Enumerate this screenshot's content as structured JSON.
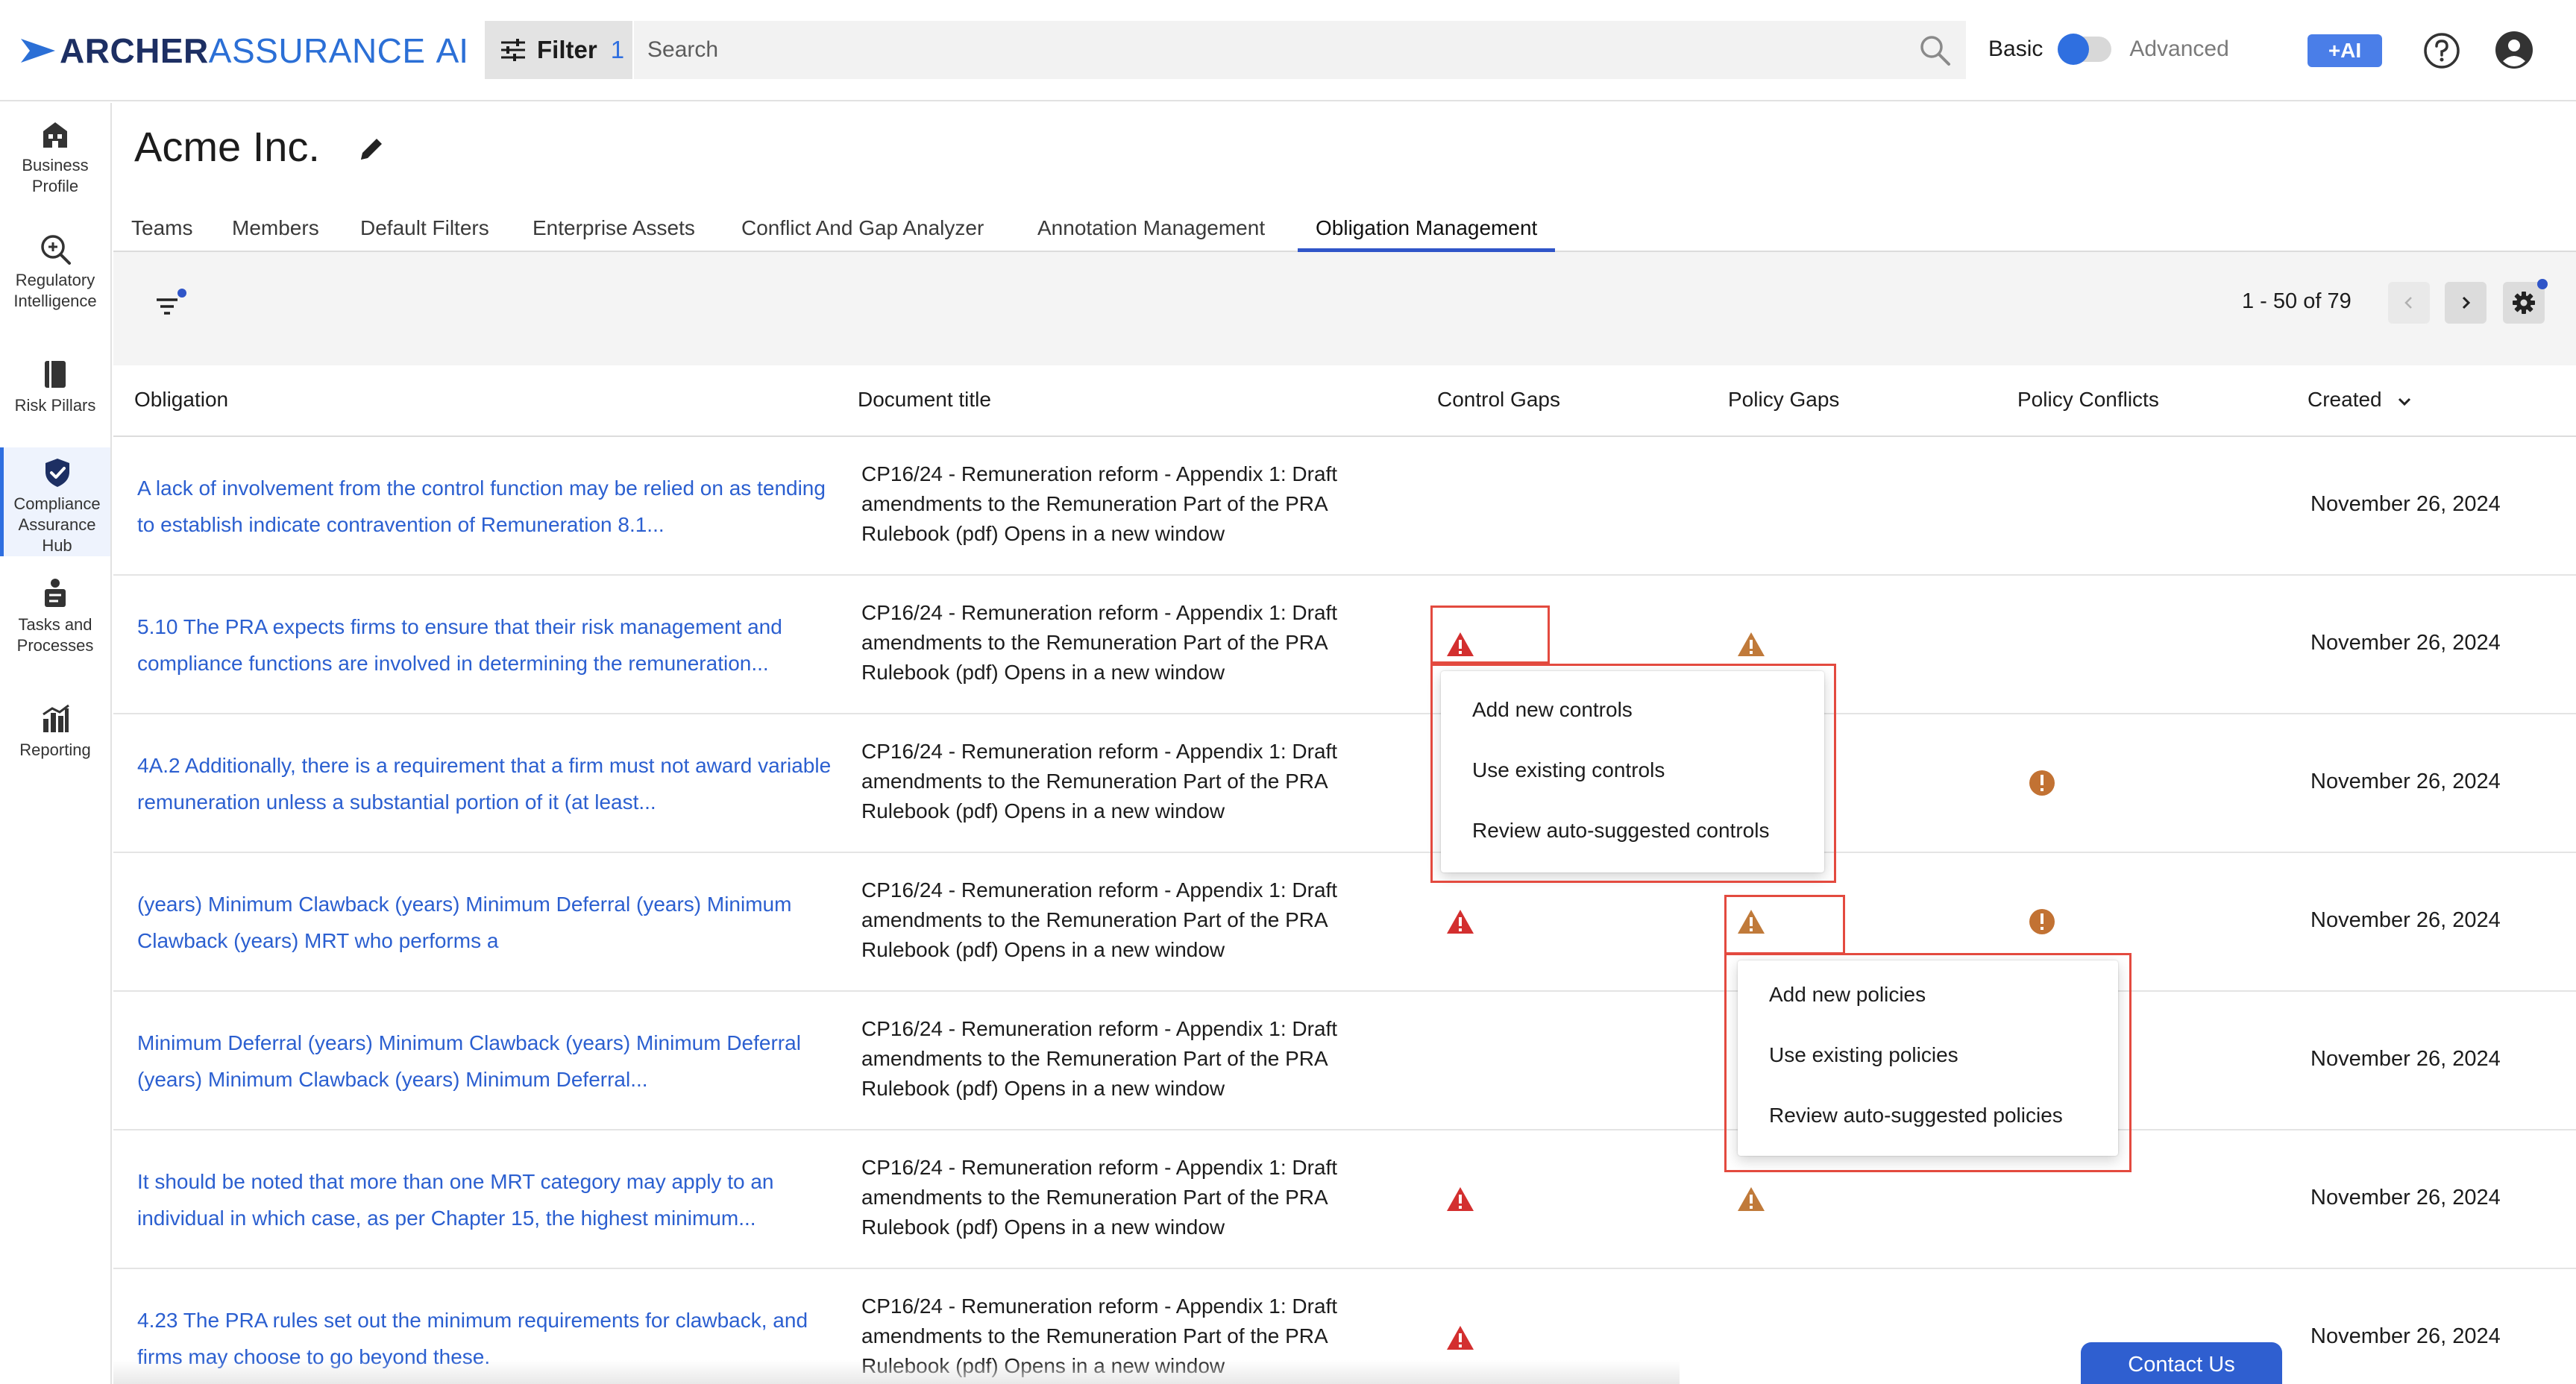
{
  "app": {
    "brand_part1": "ARCHER",
    "brand_part2": "ASSURANCE",
    "brand_part3": "AI"
  },
  "topbar": {
    "filter_label": "Filter",
    "filter_count": "1",
    "search_placeholder": "Search",
    "mode_basic": "Basic",
    "mode_advanced": "Advanced",
    "ai_button": "+AI"
  },
  "sidebar": {
    "items": [
      {
        "label": "Business Profile",
        "icon": "building-icon"
      },
      {
        "label": "Regulatory Intelligence",
        "icon": "magnify-icon"
      },
      {
        "label": "Risk Pillars",
        "icon": "book-icon"
      },
      {
        "label": "Compliance Assurance Hub",
        "icon": "shield-check-icon"
      },
      {
        "label": "Tasks and Processes",
        "icon": "tasks-icon"
      },
      {
        "label": "Reporting",
        "icon": "chart-icon"
      }
    ]
  },
  "page": {
    "title": "Acme Inc."
  },
  "tabs": [
    {
      "label": "Teams"
    },
    {
      "label": "Members"
    },
    {
      "label": "Default Filters"
    },
    {
      "label": "Enterprise Assets"
    },
    {
      "label": "Conflict And Gap Analyzer"
    },
    {
      "label": "Annotation Management"
    },
    {
      "label": "Obligation Management"
    }
  ],
  "toolbar": {
    "pager": "1 - 50 of 79"
  },
  "table": {
    "columns": [
      "Obligation",
      "Document title",
      "Control Gaps",
      "Policy Gaps",
      "Policy Conflicts",
      "Created"
    ],
    "rows": [
      {
        "obligation": "A lack of involvement from the control function may be relied on as tending to establish indicate contravention of Remuneration 8.1...",
        "document": "CP16/24 - Remuneration reform - Appendix 1: Draft amendments to the Remuneration Part of the PRA Rulebook (pdf) Opens in a new window",
        "created": "November 26, 2024"
      },
      {
        "obligation": "5.10 The PRA expects firms to ensure that their risk management and compliance functions are involved in determining the remuneration...",
        "document": "CP16/24 - Remuneration reform - Appendix 1: Draft amendments to the Remuneration Part of the PRA Rulebook (pdf) Opens in a new window",
        "created": "November 26, 2024"
      },
      {
        "obligation": "4A.2 Additionally, there is a requirement that a firm must not award variable remuneration unless a substantial portion of it (at least...",
        "document": "CP16/24 - Remuneration reform - Appendix 1: Draft amendments to the Remuneration Part of the PRA Rulebook (pdf) Opens in a new window",
        "created": "November 26, 2024"
      },
      {
        "obligation": "(years) Minimum Clawback (years) Minimum Deferral (years) Minimum Clawback (years) MRT who performs a",
        "document": "CP16/24 - Remuneration reform - Appendix 1: Draft amendments to the Remuneration Part of the PRA Rulebook (pdf) Opens in a new window",
        "created": "November 26, 2024"
      },
      {
        "obligation": "Minimum Deferral (years) Minimum Clawback (years) Minimum Deferral (years) Minimum Clawback (years) Minimum Deferral...",
        "document": "CP16/24 - Remuneration reform - Appendix 1: Draft amendments to the Remuneration Part of the PRA Rulebook (pdf) Opens in a new window",
        "created": "November 26, 2024"
      },
      {
        "obligation": "It should be noted that more than one MRT category may apply to an individual in which case, as per Chapter 15, the highest minimum...",
        "document": "CP16/24 - Remuneration reform - Appendix 1: Draft amendments to the Remuneration Part of the PRA Rulebook (pdf) Opens in a new window",
        "created": "November 26, 2024"
      },
      {
        "obligation": "4.23 The PRA rules set out the minimum requirements for clawback, and firms may choose to go beyond these.",
        "document": "CP16/24 - Remuneration reform - Appendix 1: Draft amendments to the Remuneration Part of the PRA Rulebook (pdf) Opens in a new window",
        "created": "November 26, 2024"
      }
    ]
  },
  "control_menu": {
    "items": [
      "Add new controls",
      "Use existing controls",
      "Review auto-suggested controls"
    ]
  },
  "policy_menu": {
    "items": [
      "Add new policies",
      "Use existing policies",
      "Review auto-suggested policies"
    ]
  },
  "contact": {
    "label": "Contact Us"
  },
  "colors": {
    "accent": "#2f6fe0",
    "link": "#2b5fd0",
    "control_gap": "#d32f2f",
    "policy_gap": "#c07a3a",
    "conflict": "#c27233",
    "highlight": "#e34a3f"
  }
}
